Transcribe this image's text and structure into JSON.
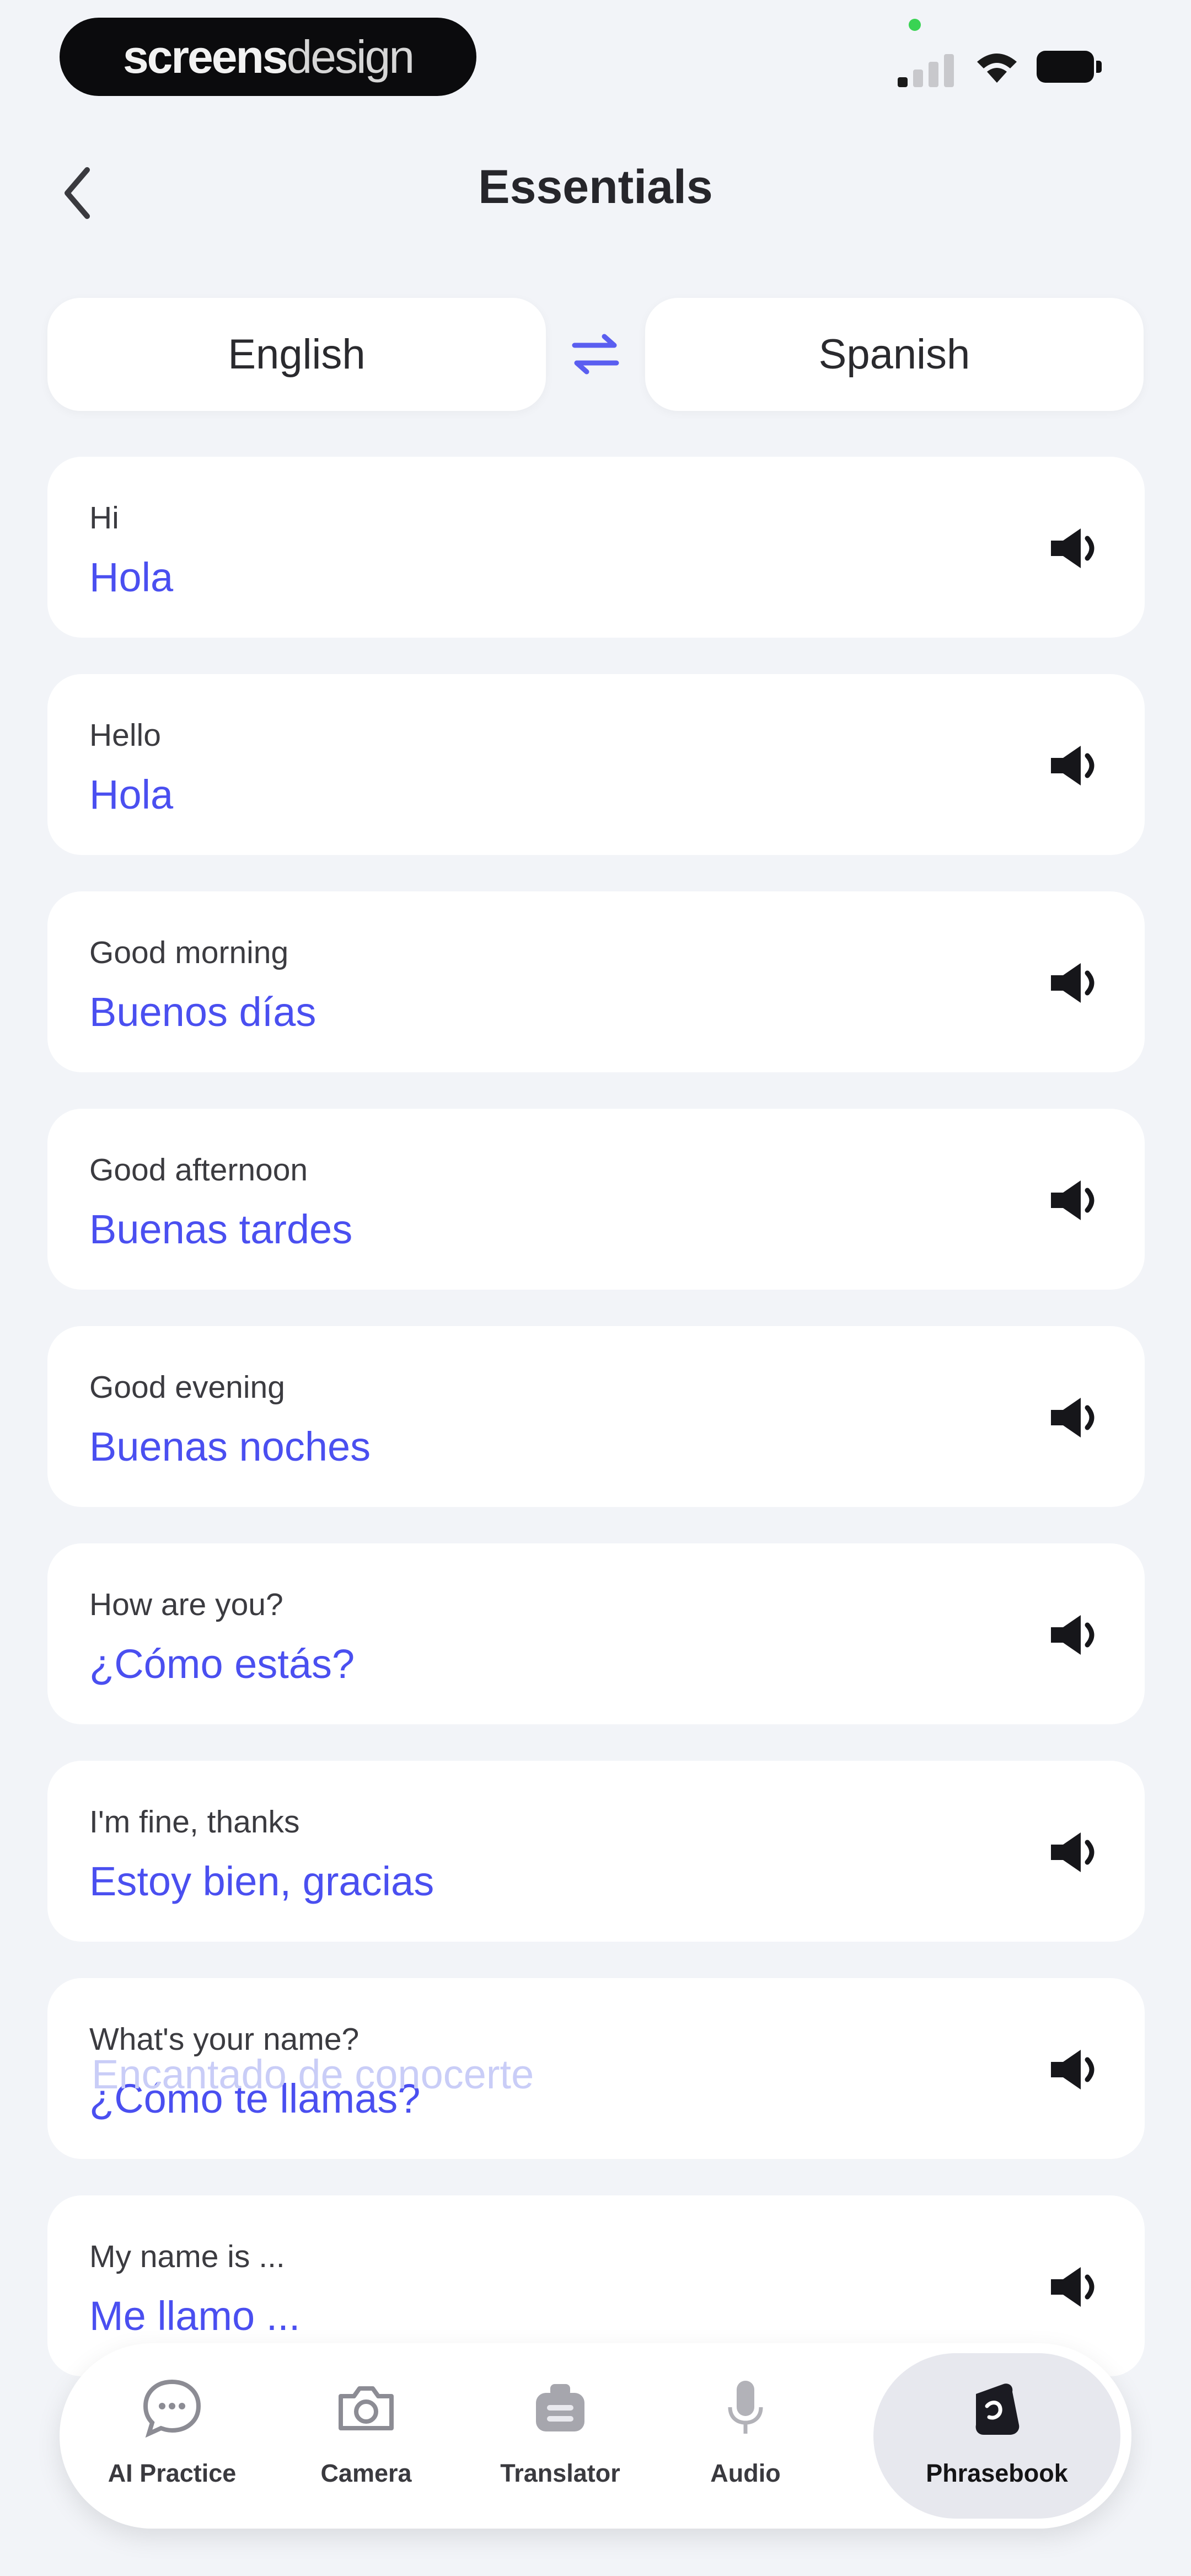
{
  "status_bar": {
    "brand_bold": "screens",
    "brand_light": "design"
  },
  "header": {
    "title": "Essentials"
  },
  "languages": {
    "source": "English",
    "target": "Spanish"
  },
  "phrases": [
    {
      "source": "Hi",
      "translation": "Hola"
    },
    {
      "source": "Hello",
      "translation": "Hola"
    },
    {
      "source": "Good morning",
      "translation": "Buenos días"
    },
    {
      "source": "Good afternoon",
      "translation": "Buenas tardes"
    },
    {
      "source": "Good evening",
      "translation": "Buenas noches"
    },
    {
      "source": "How are you?",
      "translation": "¿Cómo estás?"
    },
    {
      "source": "I'm fine, thanks",
      "translation": "Estoy bien, gracias"
    },
    {
      "source": "What's your name?",
      "translation": "¿Cómo te llamas?"
    },
    {
      "source": "My name is ...",
      "translation": "Me llamo ..."
    }
  ],
  "partial_phrase": "Encantado de conocerte",
  "bottom_nav": {
    "items": [
      {
        "label": "AI Practice",
        "icon": "chat-bubble-icon"
      },
      {
        "label": "Camera",
        "icon": "camera-icon"
      },
      {
        "label": "Translator",
        "icon": "translator-icon"
      },
      {
        "label": "Audio",
        "icon": "microphone-icon"
      },
      {
        "label": "Phrasebook",
        "icon": "phrasebook-icon",
        "active": true
      }
    ]
  },
  "colors": {
    "background": "#f2f4f8",
    "accent": "#4a4ff0",
    "card": "#ffffff"
  }
}
